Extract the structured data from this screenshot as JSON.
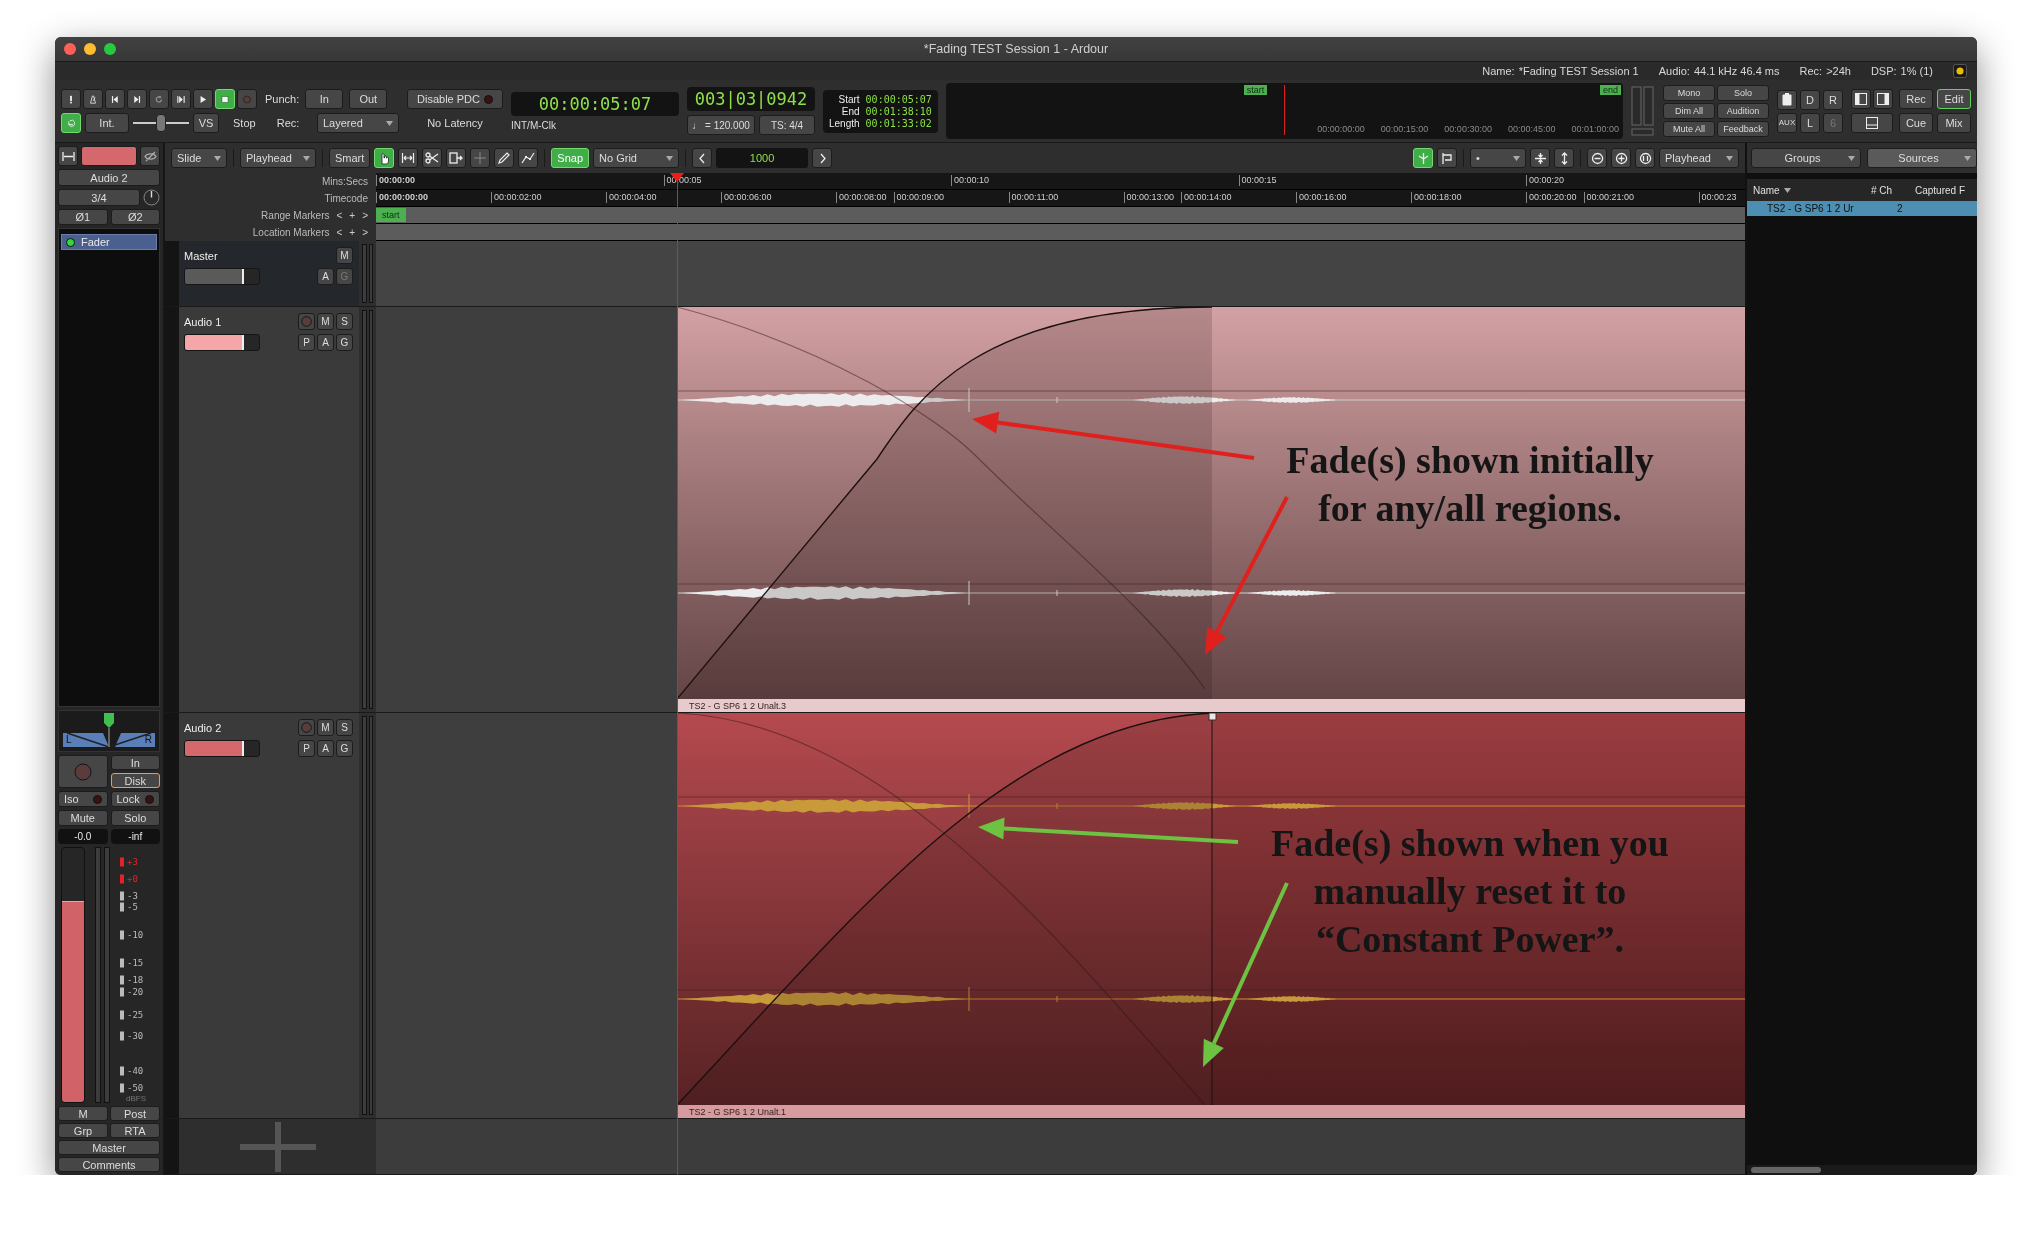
{
  "window": {
    "title": "*Fading TEST Session 1 - Ardour"
  },
  "status_bar": [
    {
      "label": "Name:",
      "value": "*Fading TEST Session 1"
    },
    {
      "label": "Audio:",
      "value": "44.1 kHz 46.4 ms"
    },
    {
      "label": "Rec:",
      "value": ">24h"
    },
    {
      "label": "DSP:",
      "value": "1% (1)"
    }
  ],
  "transport": {
    "buttons": [
      {
        "kind": "panic",
        "on": false
      },
      {
        "kind": "metronome",
        "on": false
      },
      {
        "kind": "to-start",
        "on": false
      },
      {
        "kind": "to-end",
        "on": false
      },
      {
        "kind": "loop",
        "on": false
      },
      {
        "kind": "play-range",
        "on": false
      },
      {
        "kind": "play",
        "on": false
      },
      {
        "kind": "stop",
        "on": true
      },
      {
        "kind": "record",
        "on": false
      }
    ],
    "return": {
      "on": true
    },
    "int": "Int.",
    "shuttle": {
      "level": 0.5
    },
    "vs": "VS",
    "state": "Stop"
  },
  "punch": {
    "label": "Punch:",
    "in": "In",
    "out": "Out"
  },
  "record_mode": {
    "label": "Rec:",
    "value": "Layered"
  },
  "latency": {
    "button": "Disable PDC",
    "value": "No Latency"
  },
  "primary_clock": {
    "time": "00:00:05:07",
    "sync": "INT/M-Clk"
  },
  "secondary_clock": {
    "time": "003|03|0942",
    "tempo": "♩ = 120.000",
    "meter": "TS: 4/4"
  },
  "range_clock": [
    {
      "label": "Start",
      "value": "00:00:05:07"
    },
    {
      "label": "End",
      "value": "00:01:38:10"
    },
    {
      "label": "Length",
      "value": "00:01:33:02"
    }
  ],
  "mini_timeline": {
    "markers": [
      "start",
      "end"
    ],
    "ticks": [
      "00:00:00:00",
      "00:00:15:00",
      "00:00:30:00",
      "00:00:45:00",
      "00:01:00:00"
    ]
  },
  "monitor_buttons": [
    "Mono",
    "Solo",
    "Dim All",
    "Audition",
    "Mute All",
    "Feedback"
  ],
  "mixer_buttons": [
    {
      "kind": "icon"
    },
    {
      "kind": "text",
      "label": "D",
      "disabled": false
    },
    {
      "kind": "text",
      "label": "R",
      "disabled": false
    },
    {
      "kind": "text",
      "label": "AUX",
      "disabled": false
    },
    {
      "kind": "text",
      "label": "L",
      "disabled": false
    },
    {
      "kind": "text",
      "label": "6",
      "disabled": true
    }
  ],
  "layout_toggles": [
    {
      "selected": false
    },
    {
      "selected": false
    },
    {
      "selected": false
    }
  ],
  "window_buttons": [
    {
      "label": "Rec",
      "selected": false
    },
    {
      "label": "Edit",
      "selected": true
    },
    {
      "label": "Cue",
      "selected": false
    },
    {
      "label": "Mix",
      "selected": false
    }
  ],
  "edit_toolbar": {
    "edit_mode": "Slide",
    "ripple_mode": "Playhead",
    "smart": "Smart",
    "tools": [
      {
        "kind": "grab",
        "selected": true
      },
      {
        "kind": "range",
        "selected": false
      },
      {
        "kind": "cut",
        "selected": false
      },
      {
        "kind": "stretch",
        "selected": false
      },
      {
        "kind": "audition",
        "selected": false
      },
      {
        "kind": "draw",
        "selected": false
      },
      {
        "kind": "internal",
        "selected": false
      }
    ],
    "snap": {
      "label": "Snap",
      "on": true
    },
    "grid": "No Grid",
    "nudge": "1000",
    "follow_playhead": {
      "on": true
    },
    "visible_tracks": "•",
    "zoom_focus": "Playhead"
  },
  "rulers": [
    {
      "kind": "mins",
      "label": "Mins:Secs",
      "ticks": [
        "00:00:00",
        "00:00:05",
        "00:00:10",
        "00:00:15",
        "00:00:20"
      ]
    },
    {
      "kind": "timecode",
      "label": "Timecode",
      "ticks": [
        "00:00:00:00",
        "00:00:02:00",
        "00:00:04:00",
        "00:00:06:00",
        "00:00:08:00",
        "00:00:09:00",
        "00:00:11:00",
        "00:00:13:00",
        "00:00:14:00",
        "00:00:16:00",
        "00:00:18:00",
        "00:00:20:00",
        "00:00:21:00",
        "00:00:23"
      ]
    },
    {
      "kind": "markers",
      "label": "Range Markers",
      "nav": [
        "<",
        "+",
        ">"
      ],
      "markers": [
        "start"
      ]
    },
    {
      "kind": "markers",
      "label": "Location Markers",
      "nav": [
        "<",
        "+",
        ">"
      ]
    }
  ],
  "tracks": [
    {
      "kind": "master",
      "name": "Master",
      "color": "#5a5a5a",
      "level": 0.8,
      "button_rows": [
        [
          {
            "label": "M",
            "disabled": false
          }
        ],
        [
          {
            "label": "A",
            "disabled": false
          },
          {
            "label": "G",
            "disabled": true
          }
        ]
      ]
    },
    {
      "kind": "audio",
      "name": "Audio 1",
      "color": "#f4a6a8",
      "level": 0.8,
      "record_arm": {
        "on": false
      },
      "button_rows": [
        [
          {
            "label": "M",
            "disabled": false
          },
          {
            "label": "S",
            "disabled": false
          }
        ],
        [
          {
            "label": "P",
            "disabled": false
          },
          {
            "label": "A",
            "disabled": false
          },
          {
            "label": "G",
            "disabled": false
          }
        ]
      ],
      "region": {
        "name": "TS2 - G SP6 1 2 Unalt.3",
        "kind": "initial",
        "color": "#d3a1a3"
      }
    },
    {
      "kind": "audio",
      "name": "Audio 2",
      "color": "#d4686c",
      "level": 0.8,
      "record_arm": {
        "on": false
      },
      "button_rows": [
        [
          {
            "label": "M",
            "disabled": false
          },
          {
            "label": "S",
            "disabled": false
          }
        ],
        [
          {
            "label": "P",
            "disabled": false
          },
          {
            "label": "A",
            "disabled": false
          },
          {
            "label": "G",
            "disabled": false
          }
        ]
      ],
      "region": {
        "name": "TS2 - G SP6 1 2 Unalt.1",
        "kind": "constant-power",
        "color": "#b54a4f"
      }
    }
  ],
  "annotations": [
    {
      "color": "#e0201c",
      "lines": [
        "Fade(s) shown initially",
        "for any/all regions."
      ]
    },
    {
      "color": "#6dc242",
      "lines": [
        "Fade(s) shown when you",
        "manually reset it to",
        "“Constant Power”."
      ]
    }
  ],
  "strip": {
    "name": "Audio 2",
    "color": "#d4686c",
    "input": "3/4",
    "phase": [
      "Ø1",
      "Ø2"
    ],
    "processors": [
      {
        "label": "Fader",
        "on": true,
        "selected": true
      }
    ],
    "panner": {
      "left": "L",
      "right": "R"
    },
    "monitoring": [
      {
        "label": "In",
        "selected": false
      },
      {
        "label": "Disk",
        "selected": true
      }
    ],
    "isolate": [
      {
        "label": "Iso",
        "on": false
      },
      {
        "label": "Lock",
        "on": false
      }
    ],
    "mute": "Mute",
    "solo": "Solo",
    "gain": "-0.0",
    "peak": "-inf",
    "fader": {
      "level": 0.79
    },
    "scale": [
      {
        "label": "+3",
        "color": "#e0242a"
      },
      {
        "label": "+0",
        "color": "#e0242a"
      },
      {
        "label": "-3",
        "color": "#bbbbbb"
      },
      {
        "label": "-5",
        "color": "#bbbbbb"
      },
      {
        "label": "-10",
        "color": "#bbbbbb"
      },
      {
        "label": "-15",
        "color": "#bbbbbb"
      },
      {
        "label": "-18",
        "color": "#bbbbbb"
      },
      {
        "label": "-20",
        "color": "#bbbbbb"
      },
      {
        "label": "-25",
        "color": "#bbbbbb"
      },
      {
        "label": "-30",
        "color": "#bbbbbb"
      },
      {
        "label": "-40",
        "color": "#bbbbbb"
      },
      {
        "label": "-50",
        "color": "#bbbbbb"
      }
    ],
    "unit": "dBFS",
    "buttons": [
      "M",
      "Post",
      "Grp",
      "RTA",
      "Master",
      "Comments"
    ]
  },
  "sources": {
    "tabs": [
      {
        "label": "Groups",
        "selected": false
      },
      {
        "label": "Sources",
        "selected": true
      }
    ],
    "columns": [
      "Name",
      "# Ch",
      "Captured F"
    ],
    "rows": [
      {
        "cells": [
          "TS2 - G SP6 1 2 Ur",
          "2"
        ],
        "selected": true
      }
    ]
  }
}
